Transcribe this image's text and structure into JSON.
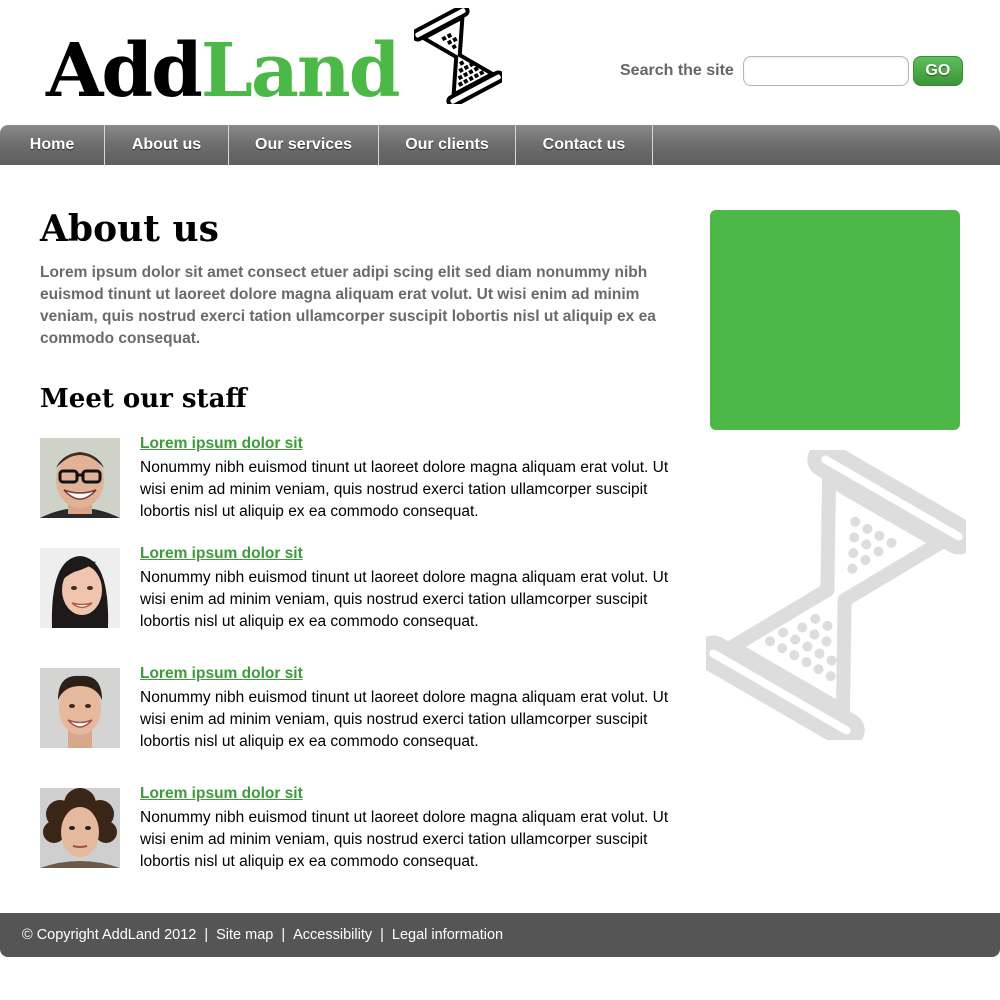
{
  "logo": {
    "part1": "Add",
    "part2": "Land",
    "icon": "hourglass-icon"
  },
  "search": {
    "label": "Search the site",
    "value": "",
    "placeholder": "",
    "go_label": "GO"
  },
  "nav": {
    "items": [
      {
        "label": "Home"
      },
      {
        "label": "About us"
      },
      {
        "label": "Our services"
      },
      {
        "label": "Our clients"
      },
      {
        "label": "Contact us"
      }
    ]
  },
  "main": {
    "title": "About us",
    "intro": "Lorem ipsum dolor sit amet consect etuer adipi scing elit sed diam nonummy nibh euismod tinunt ut laoreet dolore magna aliquam erat volut. Ut wisi enim ad minim veniam, quis nostrud exerci tation ullamcorper suscipit lobortis nisl ut aliquip ex ea commodo consequat.",
    "staff_title": "Meet our staff",
    "staff": [
      {
        "name": "Lorem ipsum dolor sit",
        "desc": "Nonummy nibh euismod tinunt ut laoreet dolore magna aliquam erat volut. Ut wisi enim ad minim veniam, quis nostrud exerci tation ullamcorper suscipit lobortis nisl ut aliquip ex ea commodo consequat."
      },
      {
        "name": "Lorem ipsum dolor sit",
        "desc": "Nonummy nibh euismod tinunt ut laoreet dolore magna aliquam erat volut. Ut wisi enim ad minim veniam, quis nostrud exerci tation ullamcorper suscipit lobortis nisl ut aliquip ex ea commodo consequat."
      },
      {
        "name": "Lorem ipsum dolor sit",
        "desc": "Nonummy nibh euismod tinunt ut laoreet dolore magna aliquam erat volut. Ut wisi enim ad minim veniam, quis nostrud exerci tation ullamcorper suscipit lobortis nisl ut aliquip ex ea commodo consequat."
      },
      {
        "name": "Lorem ipsum dolor sit",
        "desc": "Nonummy nibh euismod tinunt ut laoreet dolore magna aliquam erat volut. Ut wisi enim ad minim veniam, quis nostrud exerci tation ullamcorper suscipit lobortis nisl ut aliquip ex ea commodo consequat."
      }
    ]
  },
  "footer": {
    "copyright": "© Copyright AddLand 2012",
    "links": [
      "Site map",
      "Accessibility",
      "Legal information"
    ],
    "separator": "|"
  },
  "colors": {
    "brand_green": "#4cb848",
    "link_green": "#3d9c39",
    "nav_gray": "#6d6d6d",
    "footer_gray": "#555555"
  }
}
